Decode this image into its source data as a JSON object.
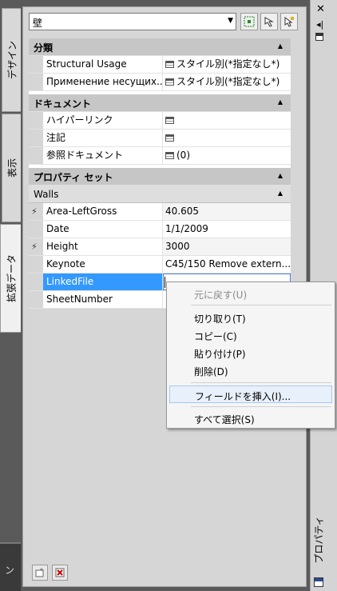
{
  "header": {
    "selector_value": "壁"
  },
  "tabs": [
    {
      "label": "デザイン"
    },
    {
      "label": "表示"
    },
    {
      "label": "拡張データ"
    }
  ],
  "side_title": "プロパティ",
  "categories": {
    "bunrui": "分類",
    "document": "ドキュメント",
    "propset": "プロパティ セット",
    "walls": "Walls"
  },
  "rows": {
    "structural_usage": {
      "name": "Structural Usage",
      "value": "スタイル別(*指定なし*)"
    },
    "primenenie": {
      "name": "Применение несущих...",
      "value": "スタイル別(*指定なし*)"
    },
    "hyperlink": {
      "name": "ハイパーリンク",
      "value": ""
    },
    "notes": {
      "name": "注記",
      "value": ""
    },
    "ref_docs": {
      "name": "参照ドキュメント",
      "value": "(0)"
    },
    "area": {
      "name": "Area-LeftGross",
      "value": "40.605"
    },
    "date": {
      "name": "Date",
      "value": "1/1/2009"
    },
    "height": {
      "name": "Height",
      "value": "3000"
    },
    "keynote": {
      "name": "Keynote",
      "value": "C45/150 Remove extern..."
    },
    "linkedfile": {
      "name": "LinkedFile",
      "value": ""
    },
    "sheetnumber": {
      "name": "SheetNumber",
      "value": ""
    }
  },
  "context_menu": {
    "undo": "元に戻す(U)",
    "cut": "切り取り(T)",
    "copy": "コピー(C)",
    "paste": "貼り付け(P)",
    "delete": "削除(D)",
    "insert_field": "フィールドを挿入(I)...",
    "select_all": "すべて選択(S)"
  },
  "bottom_left_text": "ン"
}
